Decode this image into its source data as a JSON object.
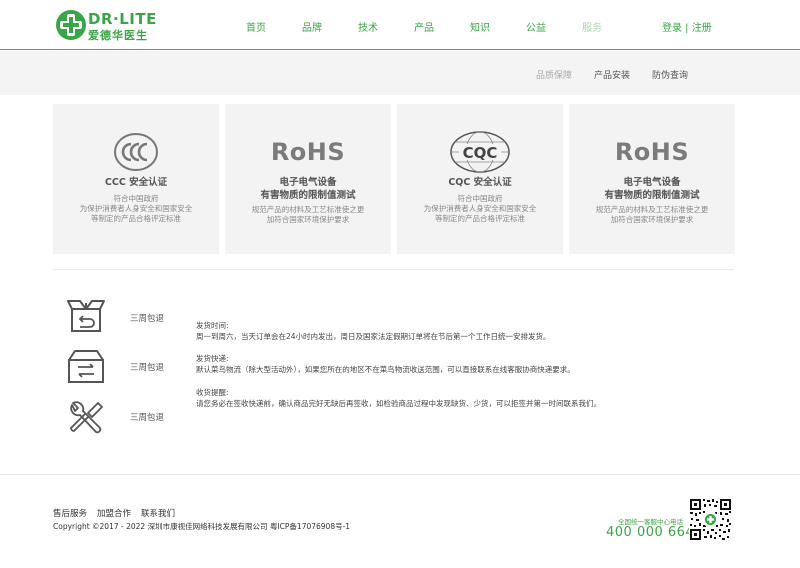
{
  "brand": {
    "logo_en": "DR·LITE",
    "logo_cn": "爱德华医生",
    "accent": "#3aa546"
  },
  "nav": {
    "items": [
      {
        "label": "首页",
        "active": false
      },
      {
        "label": "品牌",
        "active": false
      },
      {
        "label": "技术",
        "active": false
      },
      {
        "label": "产品",
        "active": false
      },
      {
        "label": "知识",
        "active": false
      },
      {
        "label": "公益",
        "active": false
      },
      {
        "label": "服务",
        "active": true
      }
    ],
    "auth": "登录 | 注册"
  },
  "subnav": {
    "items": [
      "品质保障",
      "产品安装",
      "防伪查询"
    ]
  },
  "cards": [
    {
      "mark": "CCC",
      "title": "CCC 安全认证",
      "desc": [
        "符合中国政府",
        "为保护消费者人身安全和国家安全",
        "等制定的产品合格评定标准"
      ]
    },
    {
      "mark": "RoHS",
      "title": "电子电气设备\n有害物质的限制值测试",
      "desc": [
        "规范产品的材料及工艺标准使之更",
        "加符合国家环境保护要求"
      ]
    },
    {
      "mark": "CQC",
      "title": "CQC 安全认证",
      "desc": [
        "符合中国政府",
        "为保护消费者人身安全和国家安全",
        "等制定的产品合格评定标准"
      ]
    },
    {
      "mark": "RoHS",
      "title": "电子电气设备\n有害物质的限制值测试",
      "desc": [
        "规范产品的材料及工艺标准使之更",
        "加符合国家环境保护要求"
      ]
    }
  ],
  "service": {
    "items": [
      {
        "label": "三周包退",
        "icon": "return-box-icon"
      },
      {
        "label": "三周包退",
        "icon": "exchange-box-icon"
      },
      {
        "label": "三周包退",
        "icon": "tools-icon"
      }
    ],
    "info": [
      {
        "heading": "发货时间:",
        "text": "周一到周六，当天订单会在24小时内发出，周日及国家法定假期订单将在节后第一个工作日统一安排发货。"
      },
      {
        "heading": "发货快递:",
        "text": "默认菜鸟物流（除大型活动外），如果您所在的地区不在菜鸟物流收送范围，可以直接联系在线客服协商快递要求。"
      },
      {
        "heading": "收货提醒:",
        "text": "请您务必在签收快递前，确认商品完好无缺后再签收，如检验商品过程中发现缺货、少货，可以拒签并第一时间联系我们。"
      }
    ]
  },
  "footer": {
    "links": [
      "售后服务",
      "加盟合作",
      "联系我们"
    ],
    "copyright": "Copyright ©2017 - 2022 深圳市康视佳网络科技发展有限公司 粤ICP备17076908号-1",
    "hotline_label": "全国统一客服中心电话",
    "hotline": "400 000 6648"
  }
}
